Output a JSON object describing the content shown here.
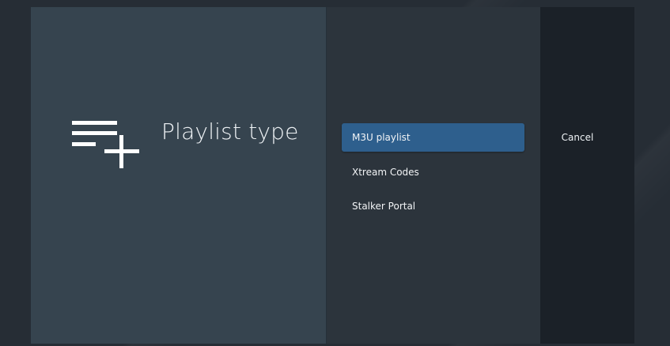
{
  "dialog": {
    "title": "Playlist type",
    "icon": "playlist-add-icon",
    "options": [
      {
        "label": "M3U playlist",
        "selected": true
      },
      {
        "label": "Xtream Codes",
        "selected": false
      },
      {
        "label": "Stalker Portal",
        "selected": false
      }
    ],
    "cancel_label": "Cancel"
  },
  "colors": {
    "background": "#262d35",
    "left_panel": "#36444f",
    "middle_panel": "#2c343c",
    "right_panel": "#1b2128",
    "selected_option": "#2e5f8d",
    "text": "#eef2f5"
  }
}
